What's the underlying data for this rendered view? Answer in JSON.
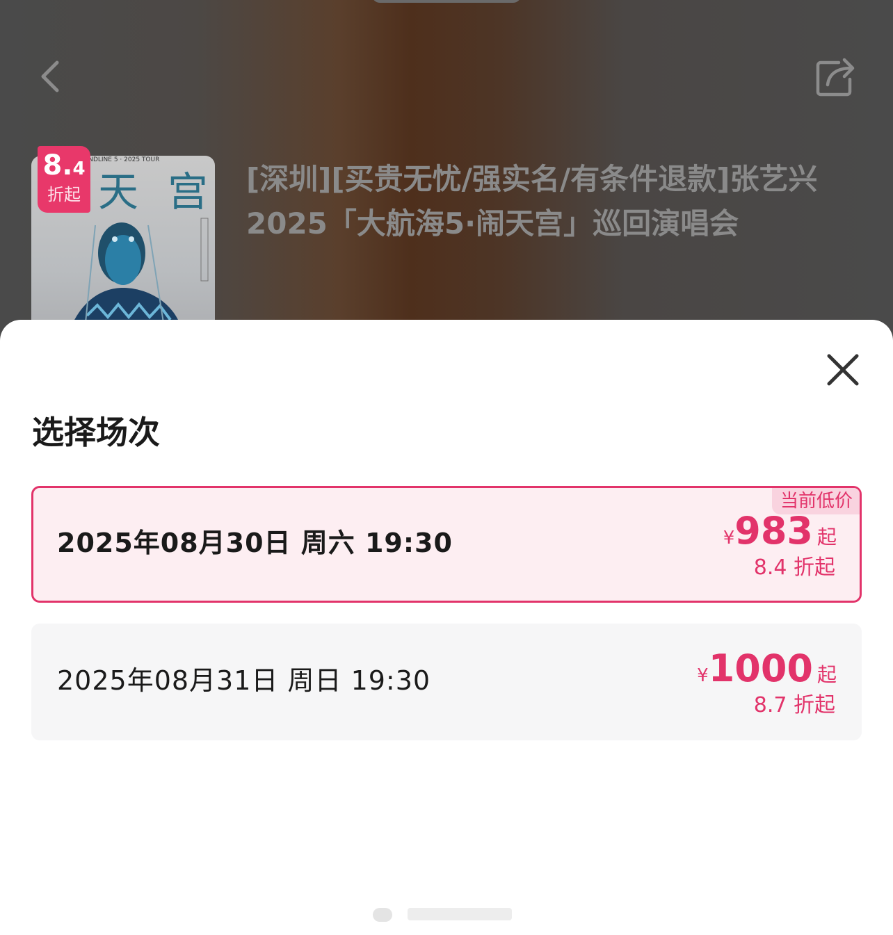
{
  "header": {
    "back_icon": "chevron-left-icon",
    "share_icon": "share-icon"
  },
  "event": {
    "title": "[深圳][买贵无忧/强实名/有条件退款]张艺兴2025「大航海5·闹天宫」巡回演唱会",
    "poster_text": "天 宫",
    "poster_tour_text": "BRANDLINE 5 · 2025 TOUR",
    "badge_number": "8.",
    "badge_decimal": "4",
    "badge_suffix": "折起"
  },
  "sheet": {
    "title": "选择场次",
    "close_icon": "close-icon",
    "sessions": [
      {
        "date": "2025年08月30日 周六 19:30",
        "currency": "¥",
        "price": "983",
        "suffix": "起",
        "discount": "8.4 折起",
        "tag": "当前低价",
        "selected": true
      },
      {
        "date": "2025年08月31日 周日 19:30",
        "currency": "¥",
        "price": "1000",
        "suffix": "起",
        "discount": "8.7 折起",
        "selected": false
      }
    ]
  },
  "colors": {
    "accent": "#e2336a",
    "selected_bg": "#fdeef2",
    "card_bg": "#f6f6f7",
    "backdrop": "#4a4a4a"
  }
}
